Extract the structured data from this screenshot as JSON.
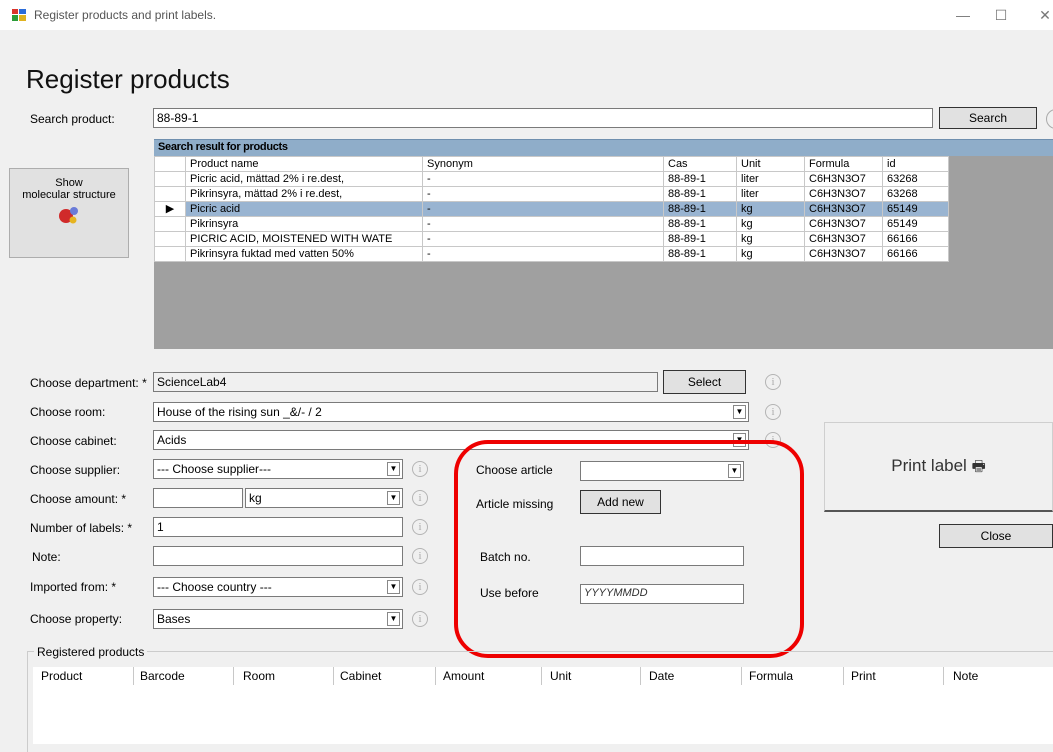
{
  "window": {
    "title": "Register products and print labels."
  },
  "heading": "Register products",
  "search": {
    "label": "Search product:",
    "value": "88-89-1",
    "button": "Search"
  },
  "molecular_button": {
    "line1": "Show",
    "line2": "molecular structure"
  },
  "results": {
    "caption": "Search result for products",
    "columns": [
      "Product name",
      "Synonym",
      "Cas",
      "Unit",
      "Formula",
      "id"
    ],
    "rows": [
      [
        "Picric acid, mättad 2% i re.dest,",
        "-",
        "88-89-1",
        "liter",
        "C6H3N3O7",
        "63268"
      ],
      [
        "Pikrinsyra, mättad 2% i re.dest,",
        "-",
        "88-89-1",
        "liter",
        "C6H3N3O7",
        "63268"
      ],
      [
        "Picric acid",
        "-",
        "88-89-1",
        "kg",
        "C6H3N3O7",
        "65149"
      ],
      [
        "Pikrinsyra",
        "-",
        "88-89-1",
        "kg",
        "C6H3N3O7",
        "65149"
      ],
      [
        "PICRIC ACID, MOISTENED WITH WATE",
        "-",
        "88-89-1",
        "kg",
        "C6H3N3O7",
        "66166"
      ],
      [
        "Pikrinsyra fuktad med vatten 50%",
        "-",
        "88-89-1",
        "kg",
        "C6H3N3O7",
        "66166"
      ]
    ],
    "selected_marker": "▶"
  },
  "form": {
    "department": {
      "label": "Choose department: *",
      "value": "ScienceLab4",
      "button": "Select"
    },
    "room": {
      "label": "Choose room:",
      "value": "House of the rising sun _&/- / 2"
    },
    "cabinet": {
      "label": "Choose cabinet:",
      "value": "Acids"
    },
    "supplier": {
      "label": "Choose supplier:",
      "value": "--- Choose supplier---"
    },
    "amount": {
      "label": "Choose amount: *",
      "value": "",
      "unit": "kg"
    },
    "labels": {
      "label": "Number of labels: *",
      "value": "1"
    },
    "note": {
      "label": "Note:",
      "value": ""
    },
    "imported": {
      "label": "Imported from: *",
      "value": "--- Choose country ---"
    },
    "property": {
      "label": "Choose property:",
      "value": "Bases"
    }
  },
  "article": {
    "choose_label": "Choose article",
    "missing_label": "Article missing",
    "add_new": "Add new",
    "batch_label": "Batch no.",
    "batch_value": "",
    "use_before_label": "Use before",
    "use_before_placeholder": "YYYYMMDD"
  },
  "print_label": "Print label",
  "close": "Close",
  "registered": {
    "title": "Registered products",
    "columns": [
      "Product",
      "Barcode",
      "Room",
      "Cabinet",
      "Amount",
      "Unit",
      "Date",
      "Formula",
      "Print",
      "Note"
    ]
  },
  "icons": {
    "info": "i",
    "printer": "🖶",
    "dropdown": "▼"
  },
  "colors": {
    "selection": "#99b4d1",
    "caption": "#8fadc9",
    "highlight_ring": "#ee0000"
  }
}
